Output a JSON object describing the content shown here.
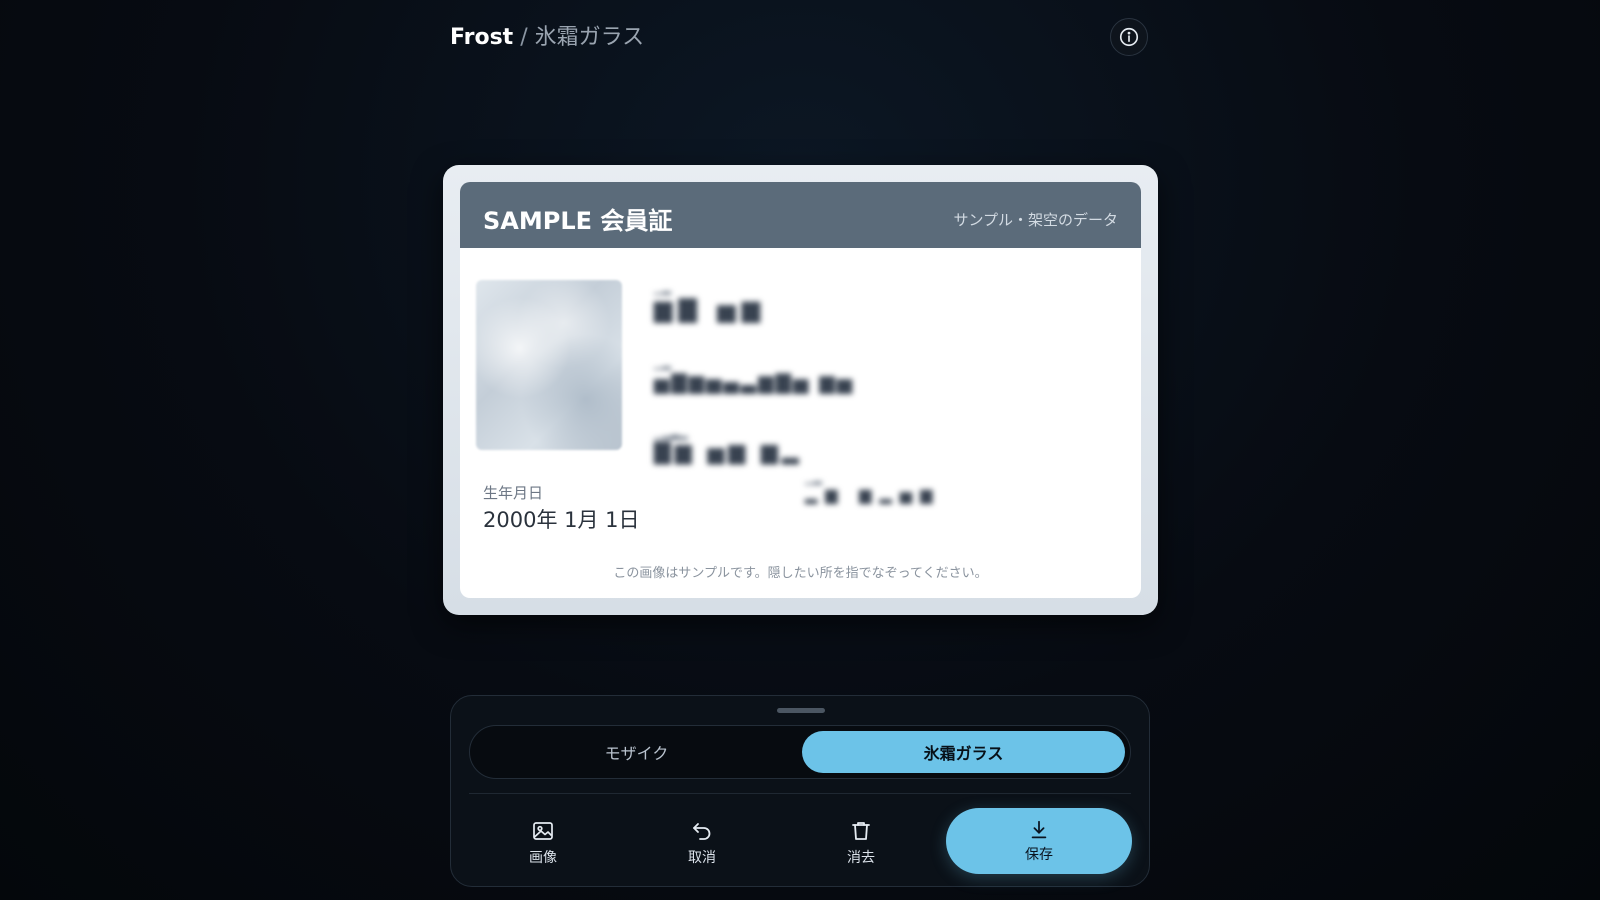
{
  "header": {
    "app_name": "Frost",
    "separator": "/",
    "mode_name": "氷霜ガラス"
  },
  "card": {
    "title": "SAMPLE 会員証",
    "subtitle": "サンプル・架空のデータ",
    "dob_label": "生年月日",
    "dob_value": "2000年 1月 1日",
    "note": "この画像はサンプルです。隠したい所を指でなぞってください。"
  },
  "panel": {
    "modes": [
      {
        "label": "モザイク",
        "selected": false
      },
      {
        "label": "氷霜ガラス",
        "selected": true
      }
    ],
    "tools": {
      "image_label": "画像",
      "undo_label": "取消",
      "clear_label": "消去",
      "save_label": "保存"
    }
  },
  "colors": {
    "accent": "#6cc3e8",
    "card_header": "#5b6b7a",
    "background": "#05080d"
  }
}
